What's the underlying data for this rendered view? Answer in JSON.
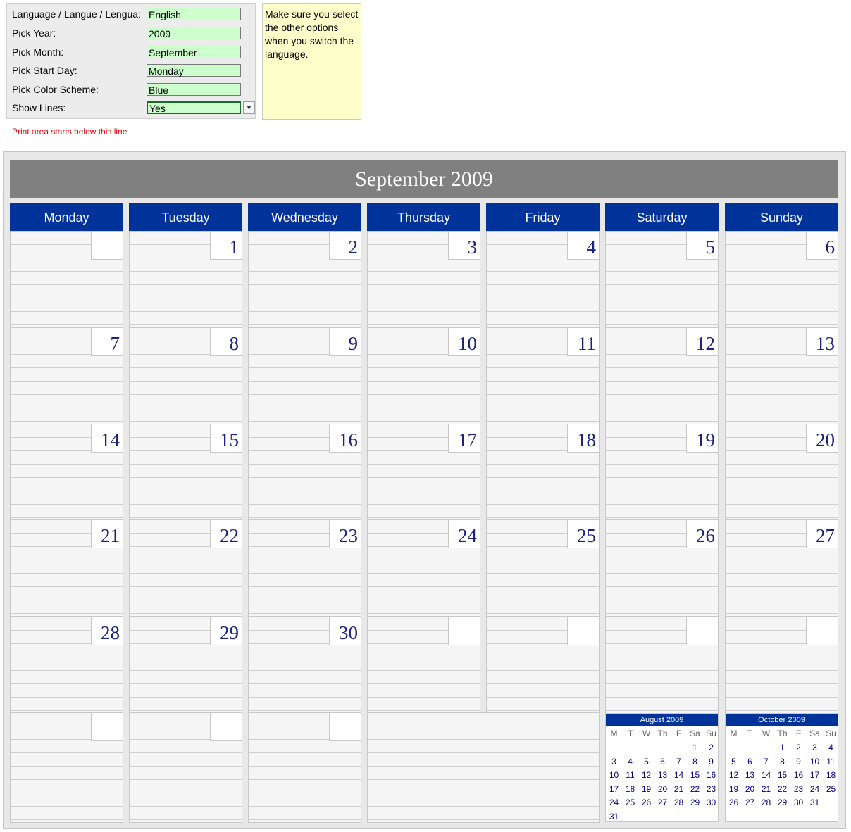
{
  "settings": {
    "rows": [
      {
        "label": "Language / Langue / Lengua:",
        "value": "English"
      },
      {
        "label": "Pick Year:",
        "value": "2009"
      },
      {
        "label": "Pick Month:",
        "value": "September"
      },
      {
        "label": "Pick Start Day:",
        "value": "Monday"
      },
      {
        "label": "Pick Color Scheme:",
        "value": "Blue"
      },
      {
        "label": "Show Lines:",
        "value": "Yes"
      }
    ],
    "dropdown_icon": "chevron-down-icon"
  },
  "note": "Make sure you select the other options when you switch the language.",
  "print_notice": "Print area starts below this line",
  "colors": {
    "header_blue": "#003399",
    "title_gray": "#808080",
    "input_green": "#ccffcc",
    "note_yellow": "#ffffcc",
    "day_number": "#1a237e",
    "notice_red": "#e00000"
  },
  "calendar": {
    "title": "September 2009",
    "day_names": [
      "Monday",
      "Tuesday",
      "Wednesday",
      "Thursday",
      "Friday",
      "Saturday",
      "Sunday"
    ],
    "weeks": [
      [
        "",
        "1",
        "2",
        "3",
        "4",
        "5",
        "6"
      ],
      [
        "7",
        "8",
        "9",
        "10",
        "11",
        "12",
        "13"
      ],
      [
        "14",
        "15",
        "16",
        "17",
        "18",
        "19",
        "20"
      ],
      [
        "21",
        "22",
        "23",
        "24",
        "25",
        "26",
        "27"
      ],
      [
        "28",
        "29",
        "30",
        "",
        "",
        "",
        ""
      ],
      [
        "",
        "",
        ""
      ]
    ]
  },
  "mini_calendars": [
    {
      "title": "August 2009",
      "headers": [
        "M",
        "T",
        "W",
        "Th",
        "F",
        "Sa",
        "Su"
      ],
      "weeks": [
        [
          "",
          "",
          "",
          "",
          "",
          "1",
          "2"
        ],
        [
          "3",
          "4",
          "5",
          "6",
          "7",
          "8",
          "9"
        ],
        [
          "10",
          "11",
          "12",
          "13",
          "14",
          "15",
          "16"
        ],
        [
          "17",
          "18",
          "19",
          "20",
          "21",
          "22",
          "23"
        ],
        [
          "24",
          "25",
          "26",
          "27",
          "28",
          "29",
          "30"
        ],
        [
          "31",
          "",
          "",
          "",
          "",
          "",
          ""
        ]
      ]
    },
    {
      "title": "October 2009",
      "headers": [
        "M",
        "T",
        "W",
        "Th",
        "F",
        "Sa",
        "Su"
      ],
      "weeks": [
        [
          "",
          "",
          "",
          "1",
          "2",
          "3",
          "4"
        ],
        [
          "5",
          "6",
          "7",
          "8",
          "9",
          "10",
          "11"
        ],
        [
          "12",
          "13",
          "14",
          "15",
          "16",
          "17",
          "18"
        ],
        [
          "19",
          "20",
          "21",
          "22",
          "23",
          "24",
          "25"
        ],
        [
          "26",
          "27",
          "28",
          "29",
          "30",
          "31",
          ""
        ]
      ]
    }
  ]
}
